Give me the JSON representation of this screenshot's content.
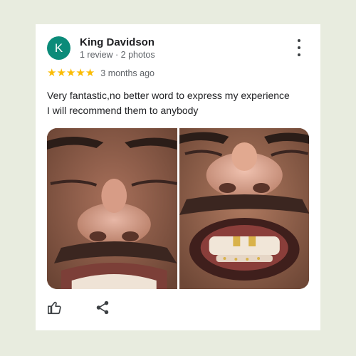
{
  "review": {
    "avatar_letter": "K",
    "avatar_color": "#0b8b79",
    "author": "King Davidson",
    "author_meta": "1 review · 2 photos",
    "rating": 5,
    "star_color": "#fbbc04",
    "stars": [
      "★",
      "★",
      "★",
      "★",
      "★"
    ],
    "time": "3 months ago",
    "text_lines": [
      "Very fantastic,no better word to express my experience",
      "I will recommend them to anybody"
    ],
    "photos": [
      {
        "name": "review-photo-1",
        "description_icon": "face-photo"
      },
      {
        "name": "review-photo-2",
        "description_icon": "face-photo"
      }
    ],
    "actions": {
      "like_icon": "thumbs-up-icon",
      "share_icon": "share-icon",
      "menu_icon": "more-vert-icon"
    }
  }
}
